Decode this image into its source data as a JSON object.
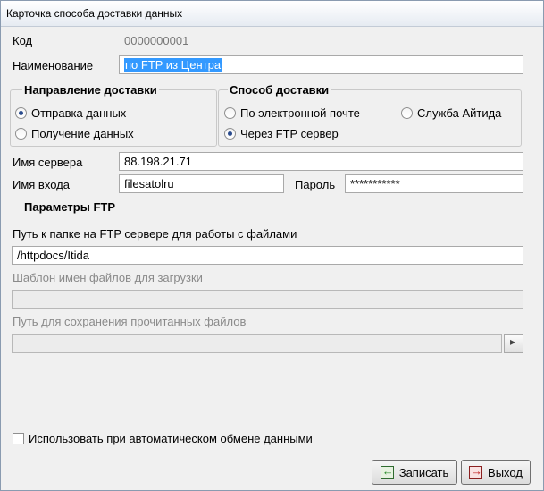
{
  "window": {
    "title": "Карточка способа доставки данных"
  },
  "fields": {
    "code_label": "Код",
    "code_value": "0000000001",
    "name_label": "Наименование",
    "name_value": "по FTP из Центра"
  },
  "direction": {
    "title": "Направление доставки",
    "options": [
      {
        "label": "Отправка данных",
        "selected": true
      },
      {
        "label": "Получение данных",
        "selected": false
      }
    ]
  },
  "method": {
    "title": "Способ доставки",
    "options": [
      {
        "label": "По электронной почте",
        "selected": false
      },
      {
        "label": "Служба Айтида",
        "selected": false
      },
      {
        "label": "Через FTP сервер",
        "selected": true
      }
    ]
  },
  "server": {
    "server_label": "Имя сервера",
    "server_value": "88.198.21.71",
    "login_label": "Имя входа",
    "login_value": "filesatolru",
    "password_label": "Пароль",
    "password_value": "***********"
  },
  "ftp": {
    "title": "Параметры FTP",
    "folder_label": "Путь к папке на FTP сервере для работы с файлами",
    "folder_value": "/httpdocs/Itida",
    "template_label": "Шаблон имен файлов для загрузки",
    "template_value": "",
    "save_path_label": "Путь для сохранения прочитанных файлов",
    "save_path_value": ""
  },
  "auto_exchange": {
    "label": "Использовать при автоматическом обмене данными",
    "checked": false
  },
  "buttons": {
    "save": "Записать",
    "exit": "Выход"
  },
  "icons": {
    "browse": "browse-icon",
    "save": "save-icon",
    "exit": "exit-icon"
  }
}
